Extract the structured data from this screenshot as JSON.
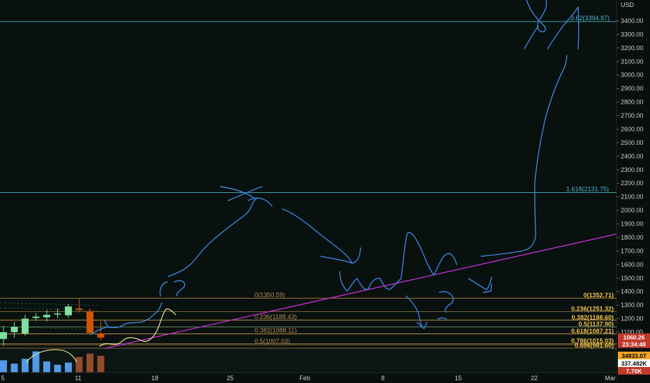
{
  "chart_data": {
    "type": "candlestick",
    "axis": {
      "currency_label": "USD",
      "price_ticks": [
        "3400.00",
        "3300.00",
        "3200.00",
        "3100.00",
        "3000.00",
        "2900.00",
        "2800.00",
        "2700.00",
        "2600.00",
        "2500.00",
        "2400.00",
        "2300.00",
        "2200.00",
        "2100.00",
        "2000.00",
        "1900.00",
        "1800.00",
        "1700.00",
        "1600.00",
        "1500.00",
        "1400.00",
        "1300.00",
        "1200.00",
        "1100.00"
      ],
      "date_ticks": [
        "5",
        "11",
        "18",
        "25",
        "Feb",
        "8",
        "15",
        "22",
        "Mar"
      ],
      "ylim": [
        1000,
        3450
      ]
    },
    "candles": [
      {
        "date": "Jan 4",
        "open": 1050,
        "high": 1145,
        "low": 1000,
        "close": 1100
      },
      {
        "date": "Jan 5",
        "open": 1100,
        "high": 1175,
        "low": 1060,
        "close": 1140
      },
      {
        "date": "Jan 6",
        "open": 1090,
        "high": 1230,
        "low": 1075,
        "close": 1200
      },
      {
        "date": "Jan 7",
        "open": 1205,
        "high": 1240,
        "low": 1185,
        "close": 1215
      },
      {
        "date": "Jan 8",
        "open": 1210,
        "high": 1265,
        "low": 1180,
        "close": 1228
      },
      {
        "date": "Jan 9",
        "open": 1232,
        "high": 1275,
        "low": 1205,
        "close": 1238
      },
      {
        "date": "Jan 10",
        "open": 1225,
        "high": 1310,
        "low": 1205,
        "close": 1290
      },
      {
        "date": "Jan 11",
        "open": 1275,
        "high": 1350,
        "low": 1245,
        "close": 1265
      },
      {
        "date": "Jan 12",
        "open": 1255,
        "high": 1275,
        "low": 1080,
        "close": 1095
      },
      {
        "date": "Jan 13",
        "open": 1090,
        "high": 1180,
        "low": 1040,
        "close": 1060
      }
    ],
    "fib_lines": [
      {
        "label": "3.62(3394.87)",
        "value": 3394.87,
        "color": "#4fb6c8"
      },
      {
        "label": "1.618(2131.75)",
        "value": 2131.75,
        "color": "#4fb6c8"
      },
      {
        "label": "0(1350.59)",
        "value": 1350.59,
        "color": "#e6a23c"
      },
      {
        "label": "0.236(1188.43)",
        "value": 1188.43,
        "color": "#e6a23c"
      },
      {
        "label": "0.382(1088.11)",
        "value": 1088.11,
        "color": "#e6a23c"
      },
      {
        "label": "0.5(1007.03)",
        "value": 1007.03,
        "color": "#e6a23c"
      }
    ],
    "fib_labels_right": [
      {
        "label": "0(1352.71)",
        "value": 1352.71,
        "color": "#f2c14e"
      },
      {
        "label": "0.236(1251.32)",
        "value": 1251.32,
        "color": "#f2c14e"
      },
      {
        "label": "0.382(1188.60)",
        "value": 1188.6,
        "color": "#f2c14e"
      },
      {
        "label": "0.5(1137.90)",
        "value": 1137.9,
        "color": "#f2c14e"
      },
      {
        "label": "0.618(1087.21)",
        "value": 1087.21,
        "color": "#f2c14e"
      },
      {
        "label": "0.786(1015.03)",
        "value": 1015.03,
        "color": "#f2c14e"
      },
      {
        "label": "0.886(981.60)",
        "value": 981.6,
        "color": "#f2c14e"
      }
    ],
    "price_tags": [
      {
        "text": "1060.26",
        "value": 1060.26,
        "bg": "#c0392b",
        "fg": "#ffffff"
      },
      {
        "text": "23:34:48",
        "value": 1040,
        "bg": "#c0392b",
        "fg": "#ffffff"
      }
    ],
    "volume_tags": [
      {
        "text": "34833.07",
        "bg": "#f5a623",
        "fg": "#000000"
      },
      {
        "text": "337.482K",
        "bg": "#ffffff",
        "fg": "#000000"
      },
      {
        "text": "7.70K",
        "bg": "#c0392b",
        "fg": "#ffffff"
      }
    ],
    "volume_bars": [
      {
        "value": 0.55,
        "color": "#5aa8ff"
      },
      {
        "value": 0.4,
        "color": "#5aa8ff"
      },
      {
        "value": 0.62,
        "color": "#5aa8ff"
      },
      {
        "value": 0.95,
        "color": "#5aa8ff"
      },
      {
        "value": 0.5,
        "color": "#5aa8ff"
      },
      {
        "value": 0.35,
        "color": "#5aa8ff"
      },
      {
        "value": 0.45,
        "color": "#5aa8ff"
      },
      {
        "value": 0.7,
        "color": "#a0522d"
      },
      {
        "value": 0.85,
        "color": "#a0522d"
      },
      {
        "value": 0.75,
        "color": "#a0522d"
      }
    ],
    "colors": {
      "bull": "#7fe0a0",
      "bear": "#d35400",
      "trendline": "#c02ccf",
      "drawing": "#3f82e0",
      "drawing_yellow": "#f3e99f"
    }
  }
}
